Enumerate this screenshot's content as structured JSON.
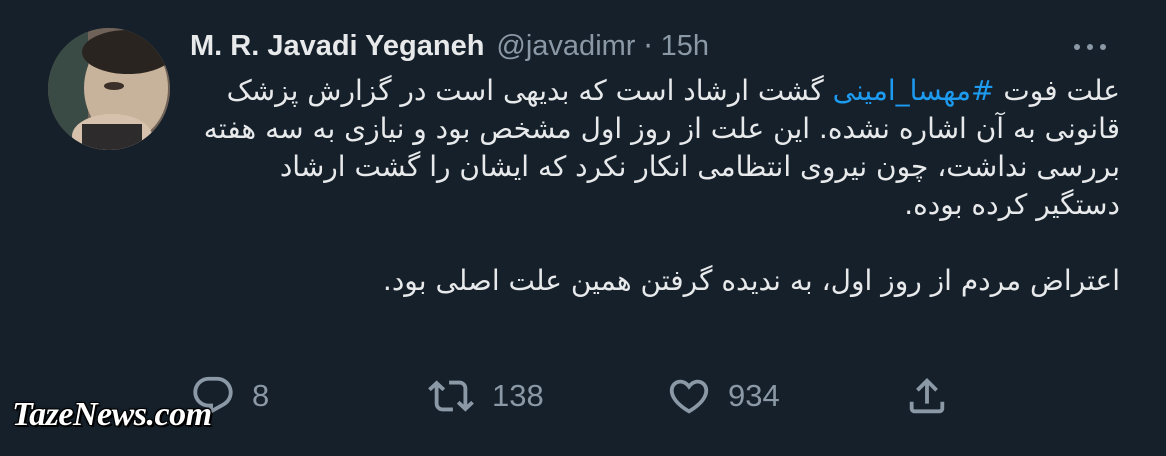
{
  "author": {
    "name": "M. R. Javadi Yeganeh",
    "handle": "@javadimr",
    "separator": "·",
    "time": "15h"
  },
  "tweet": {
    "para1_before": "علت فوت ",
    "hashtag": "#مهسا_امینی",
    "para1_after": " گشت ارشاد است که بدیهی است در گزارش پزشک قانونی به آن اشاره نشده. این علت از روز اول مشخص بود و نیازی به سه هفته بررسی نداشت، چون نیروی انتظامی انکار نکرد که ایشان را گشت ارشاد دستگیر کرده بوده.",
    "para2": "اعتراض مردم از روز اول، به ندیده گرفتن همین علت اصلی بود."
  },
  "actions": {
    "replies": "8",
    "retweets": "138",
    "likes": "934"
  },
  "icons": {
    "more": "more-dots-icon",
    "reply": "reply-icon",
    "retweet": "retweet-icon",
    "like": "heart-icon",
    "share": "share-icon"
  },
  "colors": {
    "background": "#15202b",
    "text": "#e7e9ea",
    "secondary": "#8b98a5",
    "link": "#1d9bf0"
  },
  "watermark": "TazeNews.com"
}
